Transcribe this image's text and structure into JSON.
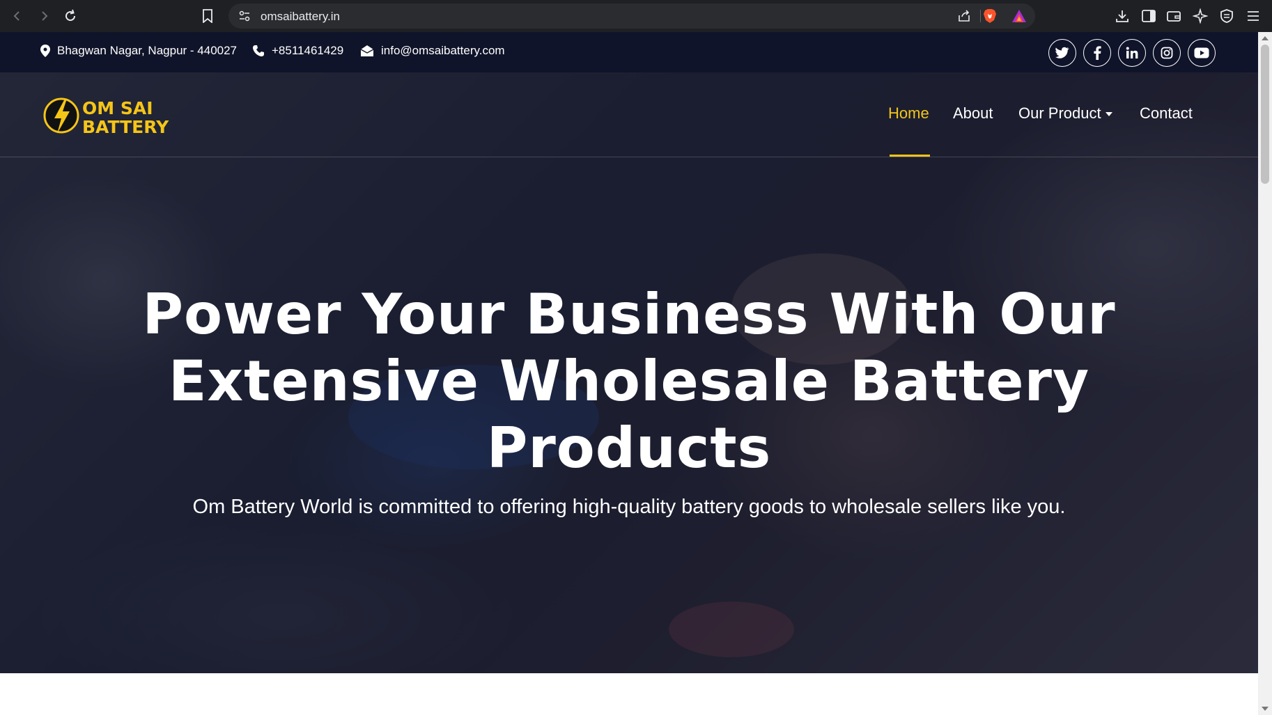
{
  "browser": {
    "url": "omsaibattery.in"
  },
  "topbar": {
    "address": "Bhagwan Nagar, Nagpur - 440027",
    "phone": "+8511461429",
    "email": "info@omsaibattery.com"
  },
  "logo": {
    "line1": "OM SAI",
    "line2": "BATTERY"
  },
  "nav": {
    "home": "Home",
    "about": "About",
    "product": "Our Product",
    "contact": "Contact"
  },
  "hero": {
    "title_line1": "Power Your Business With Our",
    "title_line2": "Extensive Wholesale Battery",
    "title_line3": "Products",
    "subtitle": "Om Battery World is committed to offering high-quality battery goods to wholesale sellers like you."
  },
  "colors": {
    "accent": "#f5c518",
    "topbar_bg": "#10142a",
    "chrome_bg": "#1f2023"
  }
}
